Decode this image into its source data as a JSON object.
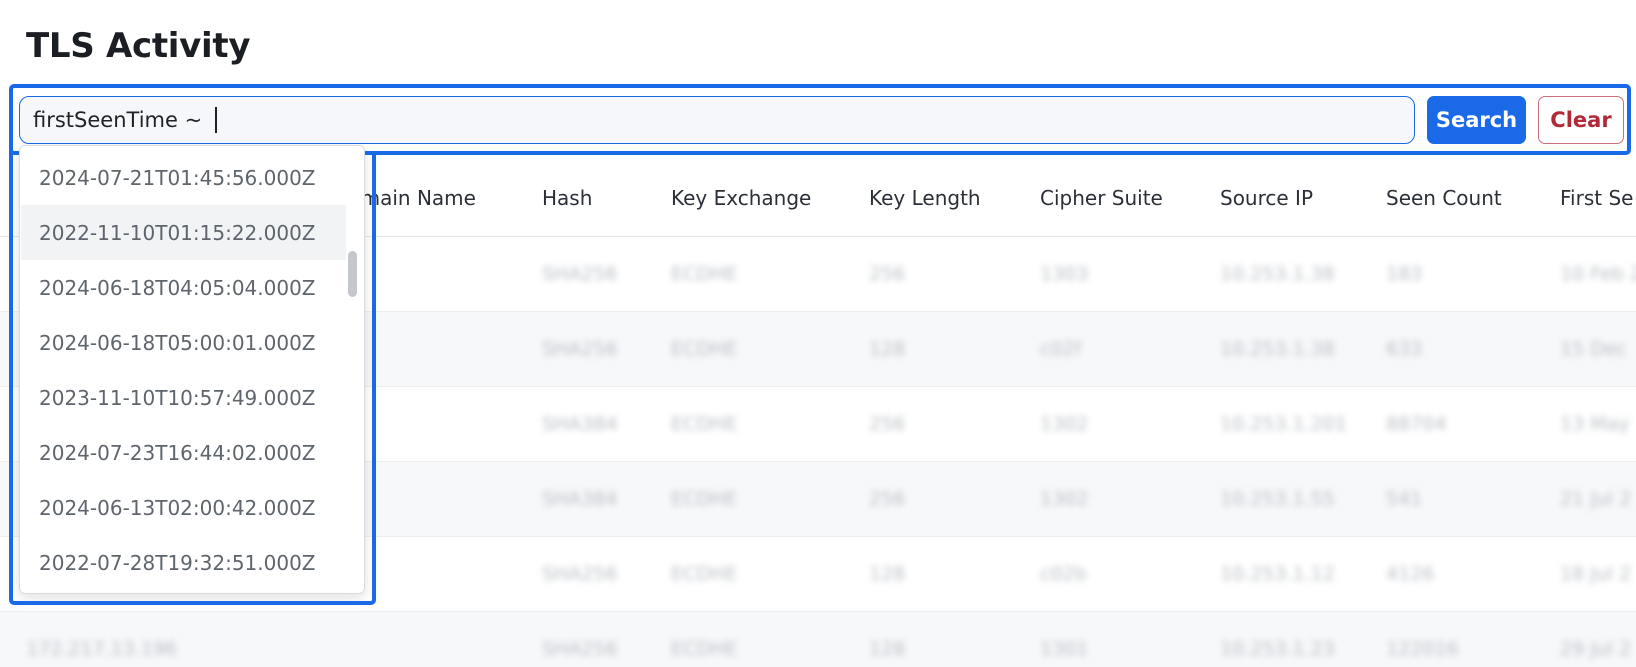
{
  "page": {
    "title": "TLS Activity"
  },
  "search": {
    "value": "firstSeenTime ~ ",
    "search_label": "Search",
    "clear_label": "Clear"
  },
  "table": {
    "headers": [
      "Domain Name",
      "Hash",
      "Key Exchange",
      "Key Length",
      "Cipher Suite",
      "Source IP",
      "Seen Count",
      "First Se"
    ],
    "rows": [
      {
        "domain": "",
        "hash": "SHA256",
        "kex": "ECDHE",
        "keylen": "256",
        "cipher": "1303",
        "src": "10.253.1.38",
        "count": "183",
        "first": "10 Feb 2"
      },
      {
        "domain": "",
        "hash": "SHA256",
        "kex": "ECDHE",
        "keylen": "128",
        "cipher": "c02f",
        "src": "10.253.1.38",
        "count": "633",
        "first": "15 Dec"
      },
      {
        "domain": "",
        "hash": "SHA384",
        "kex": "ECDHE",
        "keylen": "256",
        "cipher": "1302",
        "src": "10.253.1.201",
        "count": "88704",
        "first": "13 May"
      },
      {
        "domain": "",
        "hash": "SHA384",
        "kex": "ECDHE",
        "keylen": "256",
        "cipher": "1302",
        "src": "10.253.1.55",
        "count": "541",
        "first": "21 Jul 2"
      },
      {
        "domain": "",
        "hash": "SHA256",
        "kex": "ECDHE",
        "keylen": "128",
        "cipher": "c02b",
        "src": "10.253.1.12",
        "count": "4126",
        "first": "18 Jul 2"
      },
      {
        "domain": "172.217.13.196",
        "hash": "SHA256",
        "kex": "ECDHE",
        "keylen": "128",
        "cipher": "1301",
        "src": "10.253.1.23",
        "count": "122016",
        "first": "29 Jul 2"
      }
    ]
  },
  "suggestions": [
    "2024-07-21T01:45:56.000Z",
    "2022-11-10T01:15:22.000Z",
    "2024-06-18T04:05:04.000Z",
    "2024-06-18T05:00:01.000Z",
    "2023-11-10T10:57:49.000Z",
    "2024-07-23T16:44:02.000Z",
    "2024-06-13T02:00:42.000Z",
    "2022-07-28T19:32:51.000Z"
  ],
  "colors": {
    "accent": "#1a6ae8",
    "danger": "#b02a37",
    "highlight_frame": "#1a6ae8"
  }
}
